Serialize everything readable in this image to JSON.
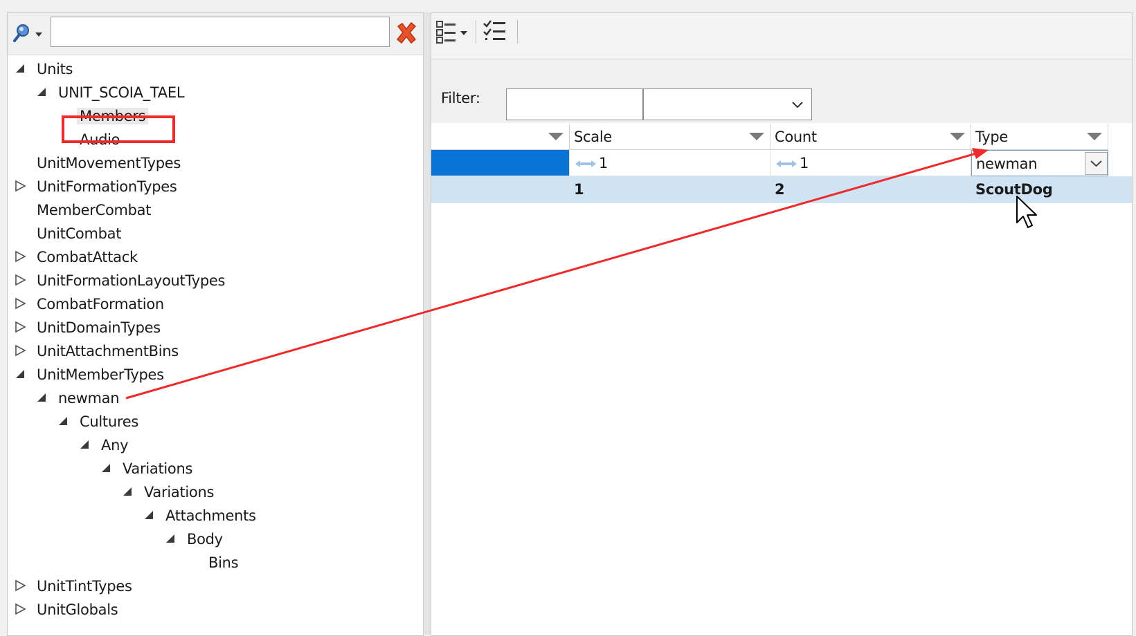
{
  "search": {
    "value": "",
    "placeholder": ""
  },
  "tree": [
    {
      "label": "Units",
      "depth": 0,
      "toggle": "expanded"
    },
    {
      "label": "UNIT_SCOIA_TAEL",
      "depth": 1,
      "toggle": "expanded"
    },
    {
      "label": "Members",
      "depth": 2,
      "toggle": "none",
      "selected": true
    },
    {
      "label": "Audio",
      "depth": 2,
      "toggle": "none"
    },
    {
      "label": "UnitMovementTypes",
      "depth": 0,
      "toggle": "none"
    },
    {
      "label": "UnitFormationTypes",
      "depth": 0,
      "toggle": "collapsed"
    },
    {
      "label": "MemberCombat",
      "depth": 0,
      "toggle": "none"
    },
    {
      "label": "UnitCombat",
      "depth": 0,
      "toggle": "none"
    },
    {
      "label": "CombatAttack",
      "depth": 0,
      "toggle": "collapsed"
    },
    {
      "label": "UnitFormationLayoutTypes",
      "depth": 0,
      "toggle": "collapsed"
    },
    {
      "label": "CombatFormation",
      "depth": 0,
      "toggle": "collapsed"
    },
    {
      "label": "UnitDomainTypes",
      "depth": 0,
      "toggle": "collapsed"
    },
    {
      "label": "UnitAttachmentBins",
      "depth": 0,
      "toggle": "collapsed"
    },
    {
      "label": "UnitMemberTypes",
      "depth": 0,
      "toggle": "expanded"
    },
    {
      "label": "newman",
      "depth": 1,
      "toggle": "expanded"
    },
    {
      "label": "Cultures",
      "depth": 2,
      "toggle": "expanded"
    },
    {
      "label": "Any",
      "depth": 3,
      "toggle": "expanded"
    },
    {
      "label": "Variations",
      "depth": 4,
      "toggle": "expanded"
    },
    {
      "label": "Variations",
      "depth": 5,
      "toggle": "expanded"
    },
    {
      "label": "Attachments",
      "depth": 6,
      "toggle": "expanded"
    },
    {
      "label": "Body",
      "depth": 7,
      "toggle": "expanded"
    },
    {
      "label": "Bins",
      "depth": 8,
      "toggle": "none"
    },
    {
      "label": "UnitTintTypes",
      "depth": 0,
      "toggle": "collapsed"
    },
    {
      "label": "UnitGlobals",
      "depth": 0,
      "toggle": "collapsed"
    }
  ],
  "filter": {
    "label": "Filter:",
    "value": "",
    "selected": ""
  },
  "grid": {
    "columns": [
      "",
      "Scale",
      "Count",
      "Type"
    ],
    "rows": [
      {
        "scale": "1",
        "count": "1",
        "type": "newman",
        "state": "editing"
      },
      {
        "scale": "1",
        "count": "2",
        "type": "ScoutDog",
        "state": "selected"
      }
    ]
  },
  "colors": {
    "highlight": "#ee2a2a",
    "accent": "#0a74d4",
    "selected_row": "#cfe3f5"
  },
  "icons": {
    "search_dropdown": "magnifier-dropdown-icon",
    "clear": "red-x-icon",
    "view_options": "view-options-icon",
    "checklist": "checklist-icon",
    "spin": "spin-arrows-icon",
    "cursor": "mouse-cursor-icon"
  }
}
